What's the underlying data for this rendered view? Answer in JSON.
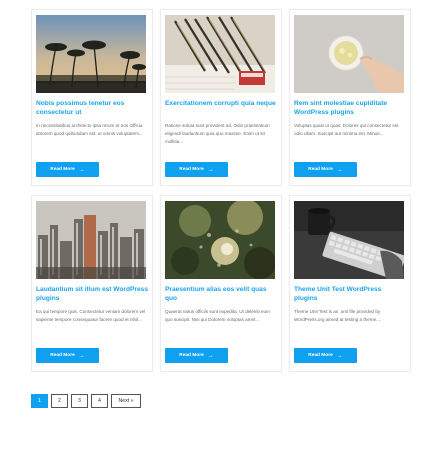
{
  "posts": [
    {
      "title": "Nobis possimus tenetur eos consectetur ut",
      "excerpt": "In necessitatibus architecto ipsa rerum et eos Officia dolorem quod quibusdam est. ut omnis voluptatem...",
      "button": "Read More",
      "image": "palm-trees-sunset"
    },
    {
      "title": "Exercitationem corrupti quia neque",
      "excerpt": "Ratione soluta sunt provident ad. Odio praesentium eligendi laudantium quia quo maxime. Enim ut sit mollitia...",
      "button": "Read More",
      "image": "pencils-and-notes"
    },
    {
      "title": "Rem sint molestiae cupiditate WordPress plugins",
      "excerpt": "Voluptas quasi ut quas. Dolores qui consectetur est odio ullam. Suscipit aut minima est. Minus...",
      "button": "Read More",
      "image": "cup-of-tea"
    },
    {
      "title": "Laudantium sit illum est WordPress plugins",
      "excerpt": "Ea qui tempore quis. Consectetur veniam dolorem vel sapiente tempore consequatur facere quod et nihil...",
      "button": "Read More",
      "image": "city-skyline"
    },
    {
      "title": "Praesentium alias eos velit quas quo",
      "excerpt": "Quaerat natus officiis sunt expedita. Ut deleniti eum quo suscipit. Nisi qui Dolorem voluptas amet...",
      "button": "Read More",
      "image": "sunlight-through-leaves"
    },
    {
      "title": "Theme Unit Test WordPress plugins",
      "excerpt": "Theme Unit Test is an .xml file provided by WordPress.org aimed at testing a theme....",
      "button": "Read More",
      "image": "keyboard-and-mug"
    }
  ],
  "pagination": {
    "pages": [
      "1",
      "2",
      "3",
      "4"
    ],
    "current": "1",
    "next_label": "Next »"
  },
  "colors": {
    "accent": "#0fa1f0",
    "title": "#1aa3ea"
  }
}
